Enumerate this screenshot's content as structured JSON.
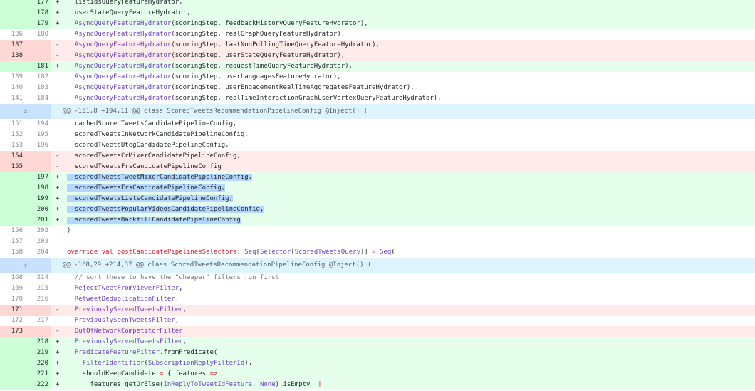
{
  "rows": [
    {
      "type": "add",
      "old": "",
      "new": "177",
      "marker": "+",
      "segs": [
        {
          "t": "  listIdsQueryFeatureHydrator,"
        }
      ]
    },
    {
      "type": "add",
      "old": "",
      "new": "178",
      "marker": "+",
      "segs": [
        {
          "t": "  userStateQueryFeatureHydrator,"
        }
      ]
    },
    {
      "type": "add",
      "old": "",
      "new": "179",
      "marker": "+",
      "segs": [
        {
          "t": "  "
        },
        {
          "t": "AsyncQueryFeatureHydrator",
          "c": "fn"
        },
        {
          "t": "(scoringStep, feedbackHistoryQueryFeatureHydrator),"
        }
      ]
    },
    {
      "type": "ctx",
      "old": "136",
      "new": "180",
      "marker": " ",
      "segs": [
        {
          "t": "  "
        },
        {
          "t": "AsyncQueryFeatureHydrator",
          "c": "fn"
        },
        {
          "t": "(scoringStep, realGraphQueryFeatureHydrator),"
        }
      ]
    },
    {
      "type": "del",
      "old": "137",
      "new": "",
      "marker": "-",
      "segs": [
        {
          "t": "  "
        },
        {
          "t": "AsyncQueryFeatureHydrator",
          "c": "fn"
        },
        {
          "t": "(scoringStep, lastNonPollingTimeQueryFeatureHydrator),"
        }
      ]
    },
    {
      "type": "del",
      "old": "138",
      "new": "",
      "marker": "-",
      "segs": [
        {
          "t": "  "
        },
        {
          "t": "AsyncQueryFeatureHydrator",
          "c": "fn"
        },
        {
          "t": "(scoringStep, userStateQueryFeatureHydrator),"
        }
      ]
    },
    {
      "type": "add",
      "old": "",
      "new": "181",
      "marker": "+",
      "segs": [
        {
          "t": "  "
        },
        {
          "t": "AsyncQueryFeatureHydrator",
          "c": "fn"
        },
        {
          "t": "(scoringStep, requestTimeQueryFeatureHydrator),"
        }
      ]
    },
    {
      "type": "ctx",
      "old": "139",
      "new": "182",
      "marker": " ",
      "segs": [
        {
          "t": "  "
        },
        {
          "t": "AsyncQueryFeatureHydrator",
          "c": "fn"
        },
        {
          "t": "(scoringStep, userLanguagesFeatureHydrator),"
        }
      ]
    },
    {
      "type": "ctx",
      "old": "140",
      "new": "183",
      "marker": " ",
      "segs": [
        {
          "t": "  "
        },
        {
          "t": "AsyncQueryFeatureHydrator",
          "c": "fn"
        },
        {
          "t": "(scoringStep, userEngagementRealTimeAggregatesFeatureHydrator),"
        }
      ]
    },
    {
      "type": "ctx",
      "old": "141",
      "new": "184",
      "marker": " ",
      "segs": [
        {
          "t": "  "
        },
        {
          "t": "AsyncQueryFeatureHydrator",
          "c": "fn"
        },
        {
          "t": "(scoringStep, realTimeInteractionGraphUserVertexQueryFeatureHydrator),"
        }
      ]
    },
    {
      "type": "hunk",
      "text": "@@ -151,8 +194,11 @@ class ScoredTweetsRecommendationPipelineConfig @Inject() ("
    },
    {
      "type": "ctx",
      "old": "151",
      "new": "194",
      "marker": " ",
      "segs": [
        {
          "t": "  cachedScoredTweetsCandidatePipelineConfig,"
        }
      ]
    },
    {
      "type": "ctx",
      "old": "152",
      "new": "195",
      "marker": " ",
      "segs": [
        {
          "t": "  scoredTweetsInNetworkCandidatePipelineConfig,"
        }
      ]
    },
    {
      "type": "ctx",
      "old": "153",
      "new": "196",
      "marker": " ",
      "segs": [
        {
          "t": "  scoredTweetsUtegCandidatePipelineConfig,"
        }
      ]
    },
    {
      "type": "del",
      "old": "154",
      "new": "",
      "marker": "-",
      "segs": [
        {
          "t": "  scoredTweetsCrMixerCandidatePipelineConfig,"
        }
      ]
    },
    {
      "type": "del",
      "old": "155",
      "new": "",
      "marker": "-",
      "segs": [
        {
          "t": "  scoredTweetsFrsCandidatePipelineConfig"
        }
      ]
    },
    {
      "type": "add",
      "old": "",
      "new": "197",
      "marker": "+",
      "sel": true,
      "segs": [
        {
          "t": "  scoredTweetsTweetMixerCandidatePipelineConfig,"
        }
      ]
    },
    {
      "type": "add",
      "old": "",
      "new": "198",
      "marker": "+",
      "sel": true,
      "segs": [
        {
          "t": "  scoredTweetsFrsCandidatePipelineConfig,"
        }
      ]
    },
    {
      "type": "add",
      "old": "",
      "new": "199",
      "marker": "+",
      "sel": true,
      "segs": [
        {
          "t": "  scoredTweetsListsCandidatePipelineConfig,"
        }
      ]
    },
    {
      "type": "add",
      "old": "",
      "new": "200",
      "marker": "+",
      "sel": true,
      "segs": [
        {
          "t": "  scoredTweetsPopularVideosCandidatePipelineConfig,"
        }
      ]
    },
    {
      "type": "add",
      "old": "",
      "new": "201",
      "marker": "+",
      "sel": true,
      "segs": [
        {
          "t": "  scoredTweetsBackfillCandidatePipelineConfig"
        }
      ]
    },
    {
      "type": "ctx",
      "old": "156",
      "new": "202",
      "marker": " ",
      "segs": [
        {
          "t": ")"
        }
      ]
    },
    {
      "type": "ctx",
      "old": "157",
      "new": "203",
      "marker": " ",
      "segs": [
        {
          "t": ""
        }
      ]
    },
    {
      "type": "ctx",
      "old": "158",
      "new": "204",
      "marker": " ",
      "segs": [
        {
          "t": "override val ",
          "c": "kw"
        },
        {
          "t": "postCandidatePipelinesSelectors",
          "c": "kw"
        },
        {
          "t": ": "
        },
        {
          "t": "Seq",
          "c": "ty"
        },
        {
          "t": "["
        },
        {
          "t": "Selector",
          "c": "ty"
        },
        {
          "t": "["
        },
        {
          "t": "ScoredTweetsQuery",
          "c": "ty"
        },
        {
          "t": "]] "
        },
        {
          "t": "=",
          "c": "op"
        },
        {
          "t": " "
        },
        {
          "t": "Seq",
          "c": "ty"
        },
        {
          "t": "("
        }
      ]
    },
    {
      "type": "hunk",
      "text": "@@ -168,29 +214,37 @@ class ScoredTweetsRecommendationPipelineConfig @Inject() ("
    },
    {
      "type": "ctx",
      "old": "168",
      "new": "214",
      "marker": " ",
      "segs": [
        {
          "t": "  "
        },
        {
          "t": "// sort these to have the \"cheaper\" filters run first",
          "c": "cm"
        }
      ]
    },
    {
      "type": "ctx",
      "old": "169",
      "new": "215",
      "marker": " ",
      "segs": [
        {
          "t": "  "
        },
        {
          "t": "RejectTweetFromViewerFilter",
          "c": "fn"
        },
        {
          "t": ","
        }
      ]
    },
    {
      "type": "ctx",
      "old": "170",
      "new": "216",
      "marker": " ",
      "segs": [
        {
          "t": "  "
        },
        {
          "t": "RetweetDeduplicationFilter",
          "c": "fn"
        },
        {
          "t": ","
        }
      ]
    },
    {
      "type": "del",
      "old": "171",
      "new": "",
      "marker": "-",
      "segs": [
        {
          "t": "  "
        },
        {
          "t": "PreviouslyServedTweetsFilter",
          "c": "fn"
        },
        {
          "t": ","
        }
      ]
    },
    {
      "type": "ctx",
      "old": "172",
      "new": "217",
      "marker": " ",
      "segs": [
        {
          "t": "  "
        },
        {
          "t": "PreviouslySeenTweetsFilter",
          "c": "fn"
        },
        {
          "t": ","
        }
      ]
    },
    {
      "type": "del",
      "old": "173",
      "new": "",
      "marker": "-",
      "segs": [
        {
          "t": "  "
        },
        {
          "t": "OutOfNetworkCompetitorFilter",
          "c": "fn"
        }
      ]
    },
    {
      "type": "add",
      "old": "",
      "new": "218",
      "marker": "+",
      "segs": [
        {
          "t": "  "
        },
        {
          "t": "PreviouslyServedTweetsFilter",
          "c": "fn"
        },
        {
          "t": ","
        }
      ]
    },
    {
      "type": "add",
      "old": "",
      "new": "219",
      "marker": "+",
      "segs": [
        {
          "t": "  "
        },
        {
          "t": "PredicateFeatureFilter",
          "c": "fn"
        },
        {
          "t": ".fromPredicate("
        }
      ]
    },
    {
      "type": "add",
      "old": "",
      "new": "220",
      "marker": "+",
      "segs": [
        {
          "t": "    "
        },
        {
          "t": "FilterIdentifier",
          "c": "fn"
        },
        {
          "t": "("
        },
        {
          "t": "SubscriptionReplyFilterId",
          "c": "fn"
        },
        {
          "t": "),"
        }
      ]
    },
    {
      "type": "add",
      "old": "",
      "new": "221",
      "marker": "+",
      "segs": [
        {
          "t": "    shouldKeepCandidate "
        },
        {
          "t": "=",
          "c": "op"
        },
        {
          "t": " { features "
        },
        {
          "t": "=>",
          "c": "op"
        }
      ]
    },
    {
      "type": "add",
      "old": "",
      "new": "222",
      "marker": "+",
      "segs": [
        {
          "t": "      features.getOrElse("
        },
        {
          "t": "InReplyToTweetIdFeature",
          "c": "fn"
        },
        {
          "t": ", "
        },
        {
          "t": "None",
          "c": "fn"
        },
        {
          "t": ").isEmpty "
        },
        {
          "t": "||",
          "c": "op"
        }
      ]
    }
  ],
  "expand_icon": "unfold-icon"
}
